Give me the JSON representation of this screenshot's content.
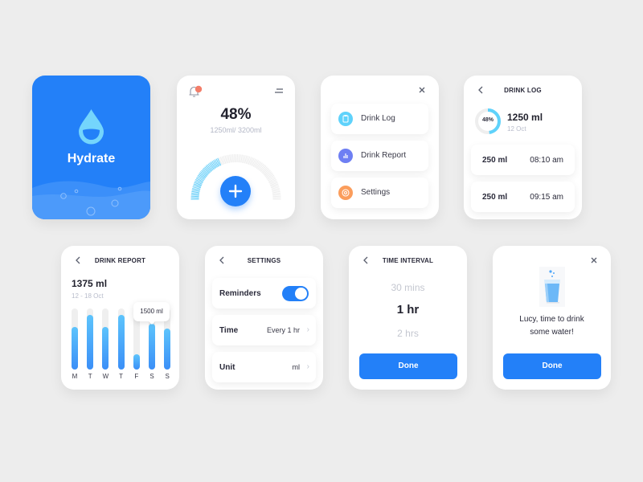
{
  "splash": {
    "title": "Hydrate",
    "icon": "water-drop-icon",
    "color": "#2380f8"
  },
  "dashboard": {
    "percent": "48%",
    "progress_fraction": 0.48,
    "amount_text": "1250ml/ 3200ml",
    "notification_icon": "bell-icon",
    "menu_icon": "menu-icon",
    "add_icon": "plus-icon"
  },
  "menu": {
    "close_icon": "close-icon",
    "items": [
      {
        "label": "Drink Log",
        "icon": "clipboard-icon",
        "color": "#5fd2fb"
      },
      {
        "label": "Drink Report",
        "icon": "bar-chart-icon",
        "color": "#6e7ff3"
      },
      {
        "label": "Settings",
        "icon": "gear-icon",
        "color": "#fb9d5c"
      }
    ]
  },
  "drink_log": {
    "title": "DRINK LOG",
    "ring_percent": "48%",
    "ring_fraction": 0.48,
    "total": "1250 ml",
    "date": "12 Oct",
    "entries": [
      {
        "amount": "250 ml",
        "time": "08:10 am"
      },
      {
        "amount": "250 ml",
        "time": "09:15 am"
      }
    ]
  },
  "drink_report": {
    "title": "DRINK REPORT",
    "total": "1375 ml",
    "range": "12 - 18 Oct",
    "tooltip": "1500 ml",
    "tooltip_day_index": 5
  },
  "chart_data": {
    "type": "bar",
    "categories": [
      "M",
      "T",
      "W",
      "T",
      "F",
      "S",
      "S"
    ],
    "values": [
      1400,
      1800,
      1400,
      1800,
      500,
      1500,
      1350
    ],
    "ylim": [
      0,
      2000
    ],
    "title": "",
    "xlabel": "",
    "ylabel": ""
  },
  "settings": {
    "title": "SETTINGS",
    "rows": [
      {
        "label": "Reminders",
        "toggle_on": true
      },
      {
        "label": "Time",
        "value": "Every 1 hr"
      },
      {
        "label": "Unit",
        "value": "ml"
      }
    ],
    "chevron": "›"
  },
  "time_interval": {
    "title": "TIME INTERVAL",
    "options": [
      "30 mins",
      "1 hr",
      "2 hrs"
    ],
    "selected": "1 hr",
    "done_label": "Done"
  },
  "reminder": {
    "message_line1": "Lucy, time to drink",
    "message_line2": "some water!",
    "done_label": "Done",
    "illustration": "water-glass-icon"
  }
}
